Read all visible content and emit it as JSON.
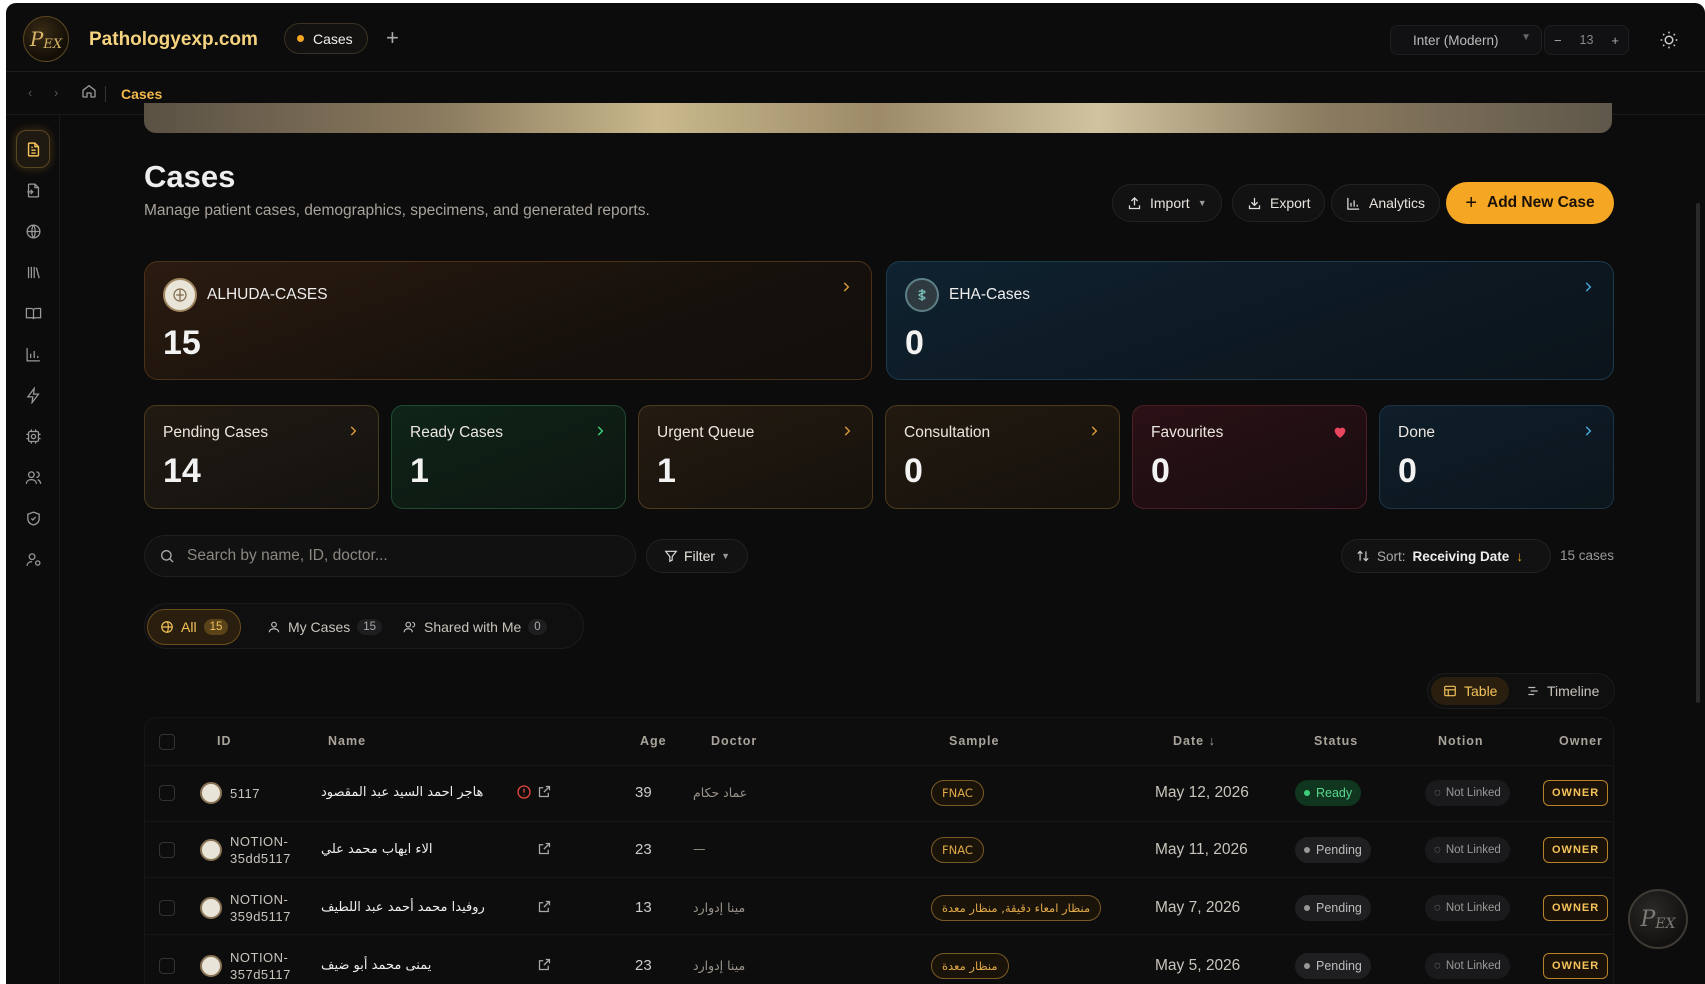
{
  "app": {
    "site_title": "Pathologyexp.com",
    "logo_text": "PEX",
    "active_tab": "Cases",
    "add_tab_symbol": "+",
    "font_select": "Inter (Modern)",
    "font_size": "13",
    "font_minus": "−",
    "font_plus": "+"
  },
  "breadcrumb": {
    "current": "Cases"
  },
  "sidebar": {
    "items": [
      {
        "icon": "document-icon",
        "active": true
      },
      {
        "icon": "file-import-icon"
      },
      {
        "icon": "globe-icon"
      },
      {
        "icon": "library-icon"
      },
      {
        "icon": "book-icon"
      },
      {
        "icon": "bar-chart-icon"
      },
      {
        "icon": "lightning-icon"
      },
      {
        "icon": "cpu-settings-icon"
      },
      {
        "icon": "users-icon"
      },
      {
        "icon": "shield-check-icon"
      },
      {
        "icon": "user-settings-icon"
      }
    ]
  },
  "header": {
    "title": "Cases",
    "subtitle": "Manage patient cases, demographics, specimens, and generated reports.",
    "import_label": "Import",
    "export_label": "Export",
    "analytics_label": "Analytics",
    "add_label": "Add New Case"
  },
  "orgs": [
    {
      "name": "ALHUDA-CASES",
      "count": "15"
    },
    {
      "name": "EHA-Cases",
      "count": "0"
    }
  ],
  "stats": [
    {
      "label": "Pending Cases",
      "value": "14"
    },
    {
      "label": "Ready Cases",
      "value": "1"
    },
    {
      "label": "Urgent Queue",
      "value": "1"
    },
    {
      "label": "Consultation",
      "value": "0"
    },
    {
      "label": "Favourites",
      "value": "0"
    },
    {
      "label": "Done",
      "value": "0"
    }
  ],
  "toolbar": {
    "search_placeholder": "Search by name, ID, doctor...",
    "filter_label": "Filter",
    "sort_prefix": "Sort:",
    "sort_value": "Receiving Date",
    "count_text": "15 cases"
  },
  "segments": [
    {
      "label": "All",
      "count": "15"
    },
    {
      "label": "My Cases",
      "count": "15"
    },
    {
      "label": "Shared with Me",
      "count": "0"
    }
  ],
  "view_toggle": {
    "table": "Table",
    "timeline": "Timeline"
  },
  "table": {
    "columns": [
      "ID",
      "Name",
      "Age",
      "Doctor",
      "Sample",
      "Date",
      "Status",
      "Notion",
      "Owner"
    ],
    "rows": [
      {
        "id": "5117",
        "id2": "",
        "name": "هاجر احمد السيد عبد المقصود",
        "age": "39",
        "doctor": "عماد حكام",
        "sample": "FNAC",
        "date": "May 12, 2026",
        "status": "Ready",
        "notion": "Not Linked",
        "owner": "OWNER",
        "alert": true
      },
      {
        "id": "NOTION-",
        "id2": "35dd5117",
        "name": "الاء ايهاب محمد علي",
        "age": "23",
        "doctor": "—",
        "sample": "FNAC",
        "date": "May 11, 2026",
        "status": "Pending",
        "notion": "Not Linked",
        "owner": "OWNER"
      },
      {
        "id": "NOTION-",
        "id2": "359d5117",
        "name": "روفيدا محمد أحمد عبد اللطيف",
        "age": "13",
        "doctor": "مينا إدوارد",
        "sample": "منظار امعاء دقيقة, منظار معدة",
        "date": "May 7, 2026",
        "status": "Pending",
        "notion": "Not Linked",
        "owner": "OWNER"
      },
      {
        "id": "NOTION-",
        "id2": "357d5117",
        "name": "يمنى محمد أبو ضيف",
        "age": "23",
        "doctor": "مينا إدوارد",
        "sample": "منظار معدة",
        "date": "May 5, 2026",
        "status": "Pending",
        "notion": "Not Linked",
        "owner": "OWNER"
      }
    ]
  },
  "colors": {
    "accent": "#f5a623",
    "ready": "#3dd07a",
    "favourite": "#e8455f"
  }
}
